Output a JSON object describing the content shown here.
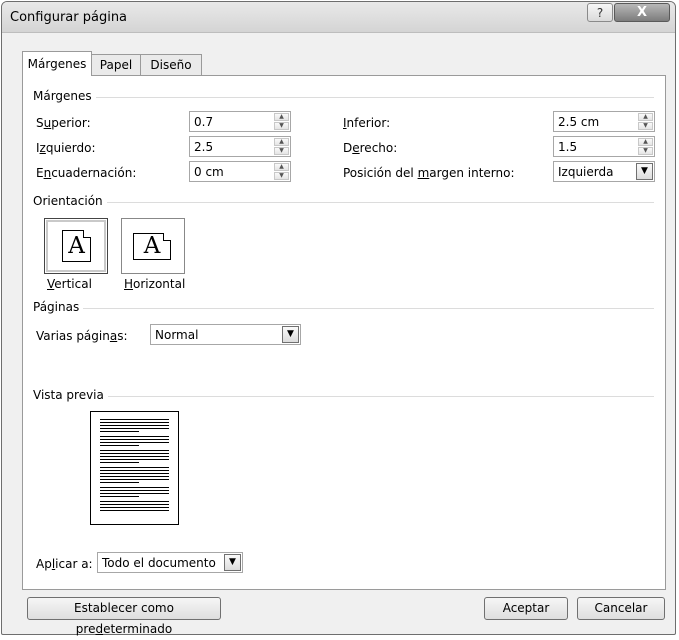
{
  "window": {
    "title": "Configurar página",
    "help_glyph": "?",
    "close_glyph": "X"
  },
  "tabs": [
    {
      "label": "Márgenes",
      "active": true
    },
    {
      "label": "Papel",
      "active": false
    },
    {
      "label": "Diseño",
      "active": false
    }
  ],
  "margins": {
    "section_label": "Márgenes",
    "top": {
      "label_pre": "S",
      "label_ul": "u",
      "label_post": "perior:",
      "value": "0.7"
    },
    "left": {
      "label_pre": "I",
      "label_ul": "z",
      "label_post": "quierdo:",
      "value": "2.5"
    },
    "gutter": {
      "label_pre": "E",
      "label_ul": "n",
      "label_post": "cuadernación:",
      "value": "0 cm"
    },
    "bottom": {
      "label_pre": "",
      "label_ul": "I",
      "label_post": "nferior:",
      "value": "2.5 cm"
    },
    "right": {
      "label_pre": "D",
      "label_ul": "e",
      "label_post": "recho:",
      "value": "1.5"
    },
    "gutter_pos": {
      "label_pre": "Posición del ",
      "label_ul": "m",
      "label_post": "argen interno:",
      "value": "Izquierda"
    }
  },
  "orientation": {
    "section_label": "Orientación",
    "portrait": {
      "label_ul": "V",
      "label_post": "ertical",
      "glyph": "A"
    },
    "landscape": {
      "label_ul": "H",
      "label_post": "orizontal",
      "glyph": "A"
    }
  },
  "pages": {
    "section_label": "Páginas",
    "multiple_label_pre": "Varias págin",
    "multiple_label_ul": "a",
    "multiple_label_post": "s:",
    "multiple_value": "Normal"
  },
  "preview": {
    "section_label": "Vista previa"
  },
  "apply": {
    "label_pre": "Ap",
    "label_ul": "l",
    "label_post": "icar a:",
    "value": "Todo el documento"
  },
  "buttons": {
    "default_pre": "Establecer como pre",
    "default_ul": "d",
    "default_post": "eterminado",
    "ok": "Aceptar",
    "cancel": "Cancelar"
  },
  "icons": {
    "spin_up": "▲",
    "spin_down": "▼",
    "dropdown": "▼"
  }
}
